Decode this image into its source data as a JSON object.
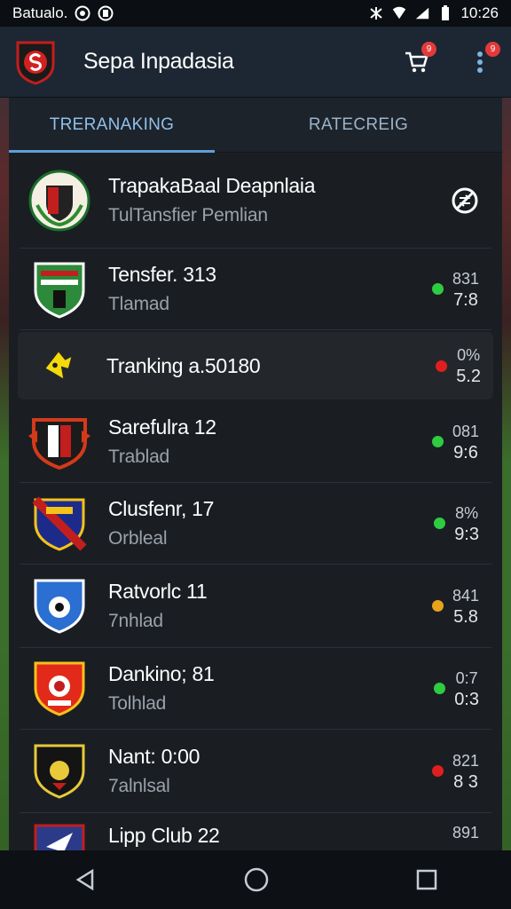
{
  "status_bar": {
    "left_text": "Batualo.",
    "time": "10:26"
  },
  "app_bar": {
    "title": "Sepa Inpadasia",
    "cart_badge": "9",
    "menu_badge": "9"
  },
  "tabs": [
    {
      "label": "TRERANAKING",
      "active": true
    },
    {
      "label": "RATECREIG",
      "active": false
    }
  ],
  "rows": [
    {
      "title": "TrapakaBaal Deapnlaia",
      "sub": "TulTansfier Pemlian",
      "n1": "",
      "n2": "",
      "status": "",
      "right_icon": "no-transfer-icon"
    },
    {
      "title": "Tensfer. 313",
      "sub": "Tlamad",
      "n1": "831",
      "n2": "7:8",
      "status": "#2ecc40"
    },
    {
      "title": "Tranking a.50180",
      "sub": "",
      "n1": "0%",
      "n2": "5.2",
      "status": "#e01e1e"
    },
    {
      "title": "Sarefulra 12",
      "sub": "Trablad",
      "n1": "081",
      "n2": "9:6",
      "status": "#2ecc40"
    },
    {
      "title": "Clusfenr, 17",
      "sub": "Orbleal",
      "n1": "8%",
      "n2": "9:3",
      "status": "#2ecc40"
    },
    {
      "title": "Ratvorlc 11",
      "sub": "7nhlad",
      "n1": "841",
      "n2": "5.8",
      "status": "#e8a21c"
    },
    {
      "title": "Dankino; 81",
      "sub": "Tolhlad",
      "n1": "0:7",
      "n2": "0:3",
      "status": "#2ecc40"
    },
    {
      "title": "Nant: 0:00",
      "sub": "7alnlsal",
      "n1": "821",
      "n2": "8 3",
      "status": "#e01e1e"
    },
    {
      "title": "Lipp Club 22",
      "sub": "",
      "n1": "891",
      "n2": "",
      "status": ""
    }
  ]
}
